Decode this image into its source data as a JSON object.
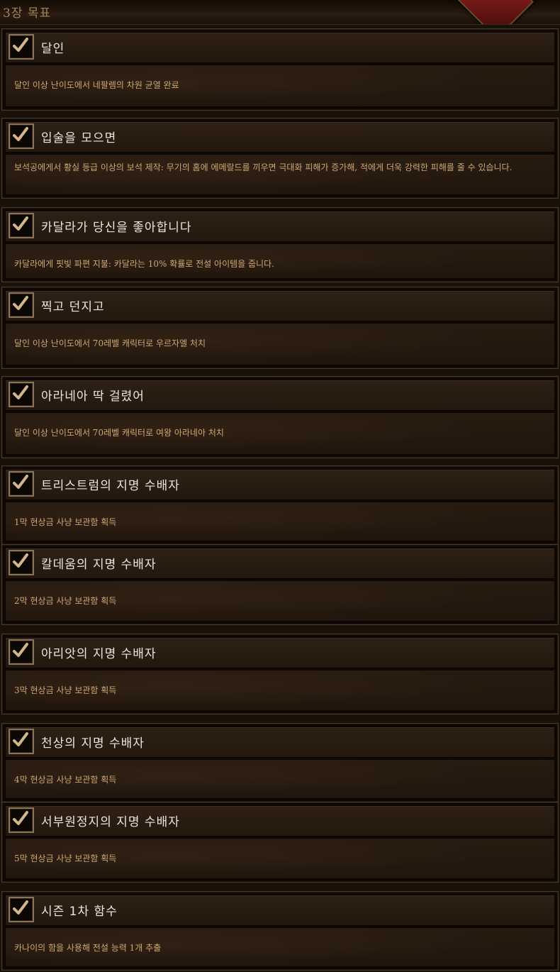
{
  "header": {
    "title": "3장 목표"
  },
  "colors": {
    "title_text": "#eae6e0",
    "description_text": "#cfa773",
    "panel_bg": "#24180e",
    "checkmark": "#d4b58a"
  },
  "objectives": [
    {
      "title": "달인",
      "description": "달인 이상 난이도에서 네팔렘의 차원 균열 완료",
      "completed": true
    },
    {
      "title": "입술을 모으면",
      "description": "보석공에게서 황실 등급 이상의 보석 제작: 무기의 홈에 에메랄드를 끼우면 극대화 피해가 증가해, 적에게 더욱 강력한 피해를 줄 수 있습니다.",
      "completed": true
    },
    {
      "title": "카달라가 당신을 좋아합니다",
      "description": "카달라에게 핏빛 파편 지불: 카달라는 10% 확률로 전설 아이템을 줍니다.",
      "completed": true
    },
    {
      "title": "찍고 던지고",
      "description": "달인 이상 난이도에서 70레벨 캐릭터로 우르자엘 처치",
      "completed": true
    },
    {
      "title": "아라네아 딱 걸렸어",
      "description": "달인 이상 난이도에서 70레벨 캐릭터로 여왕 아라네아 처치",
      "completed": true
    },
    {
      "title": "트리스트럼의 지명 수배자",
      "description": "1막 현상금 사냥 보관함 획득",
      "completed": true
    },
    {
      "title": "칼데움의 지명 수배자",
      "description": "2막 현상금 사냥 보관함 획득",
      "completed": true
    },
    {
      "title": "아리앗의 지명 수배자",
      "description": "3막 현상금 사냥 보관함 획득",
      "completed": true
    },
    {
      "title": "천상의 지명 수배자",
      "description": "4막 현상금 사냥 보관함 획득",
      "completed": true
    },
    {
      "title": "서부원정지의 지명 수배자",
      "description": "5막 현상금 사냥 보관함 획득",
      "completed": true
    },
    {
      "title": "시즌 1차 함수",
      "description": "카나이의 함을 사용해 전설 능력 1개 추출",
      "completed": true
    }
  ]
}
